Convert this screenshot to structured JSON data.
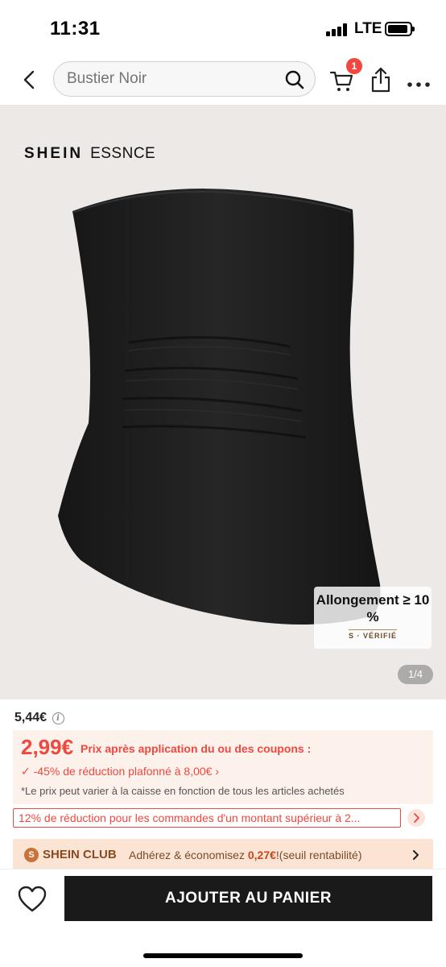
{
  "status_bar": {
    "time": "11:31",
    "network": "LTE"
  },
  "nav": {
    "search_placeholder": "Bustier Noir",
    "cart_count": "1"
  },
  "gallery": {
    "brand_main": "SHEIN",
    "brand_sub": "ESSNCE",
    "badge_title": "Allongement ≥ 10 %",
    "badge_verified": "S · VÉRIFIÉ",
    "page_indicator": "1/4",
    "product_color": "#1c1c1c"
  },
  "price": {
    "original": "5,44€",
    "coupon_price": "2,99€",
    "coupon_label": "Prix après application du ou des coupons :",
    "discount": "✓ -45% de réduction plafonné à 8,00€ ›",
    "note": "*Le prix peut varier à la caisse en fonction de tous les articles achetés"
  },
  "promo": {
    "text": "12% de réduction pour les commandes d'un montant supérieur à 2..."
  },
  "club": {
    "logo": "S",
    "name": "SHEIN CLUB",
    "text_prefix": "Adhérez & économisez ",
    "amount": "0,27€",
    "text_suffix": "!(seuil rentabilité)"
  },
  "bottom": {
    "add_to_cart": "AJOUTER AU PANIER"
  },
  "colors": {
    "accent": "#f0483e",
    "club": "#8a4a1f",
    "button": "#1a1a1a"
  }
}
